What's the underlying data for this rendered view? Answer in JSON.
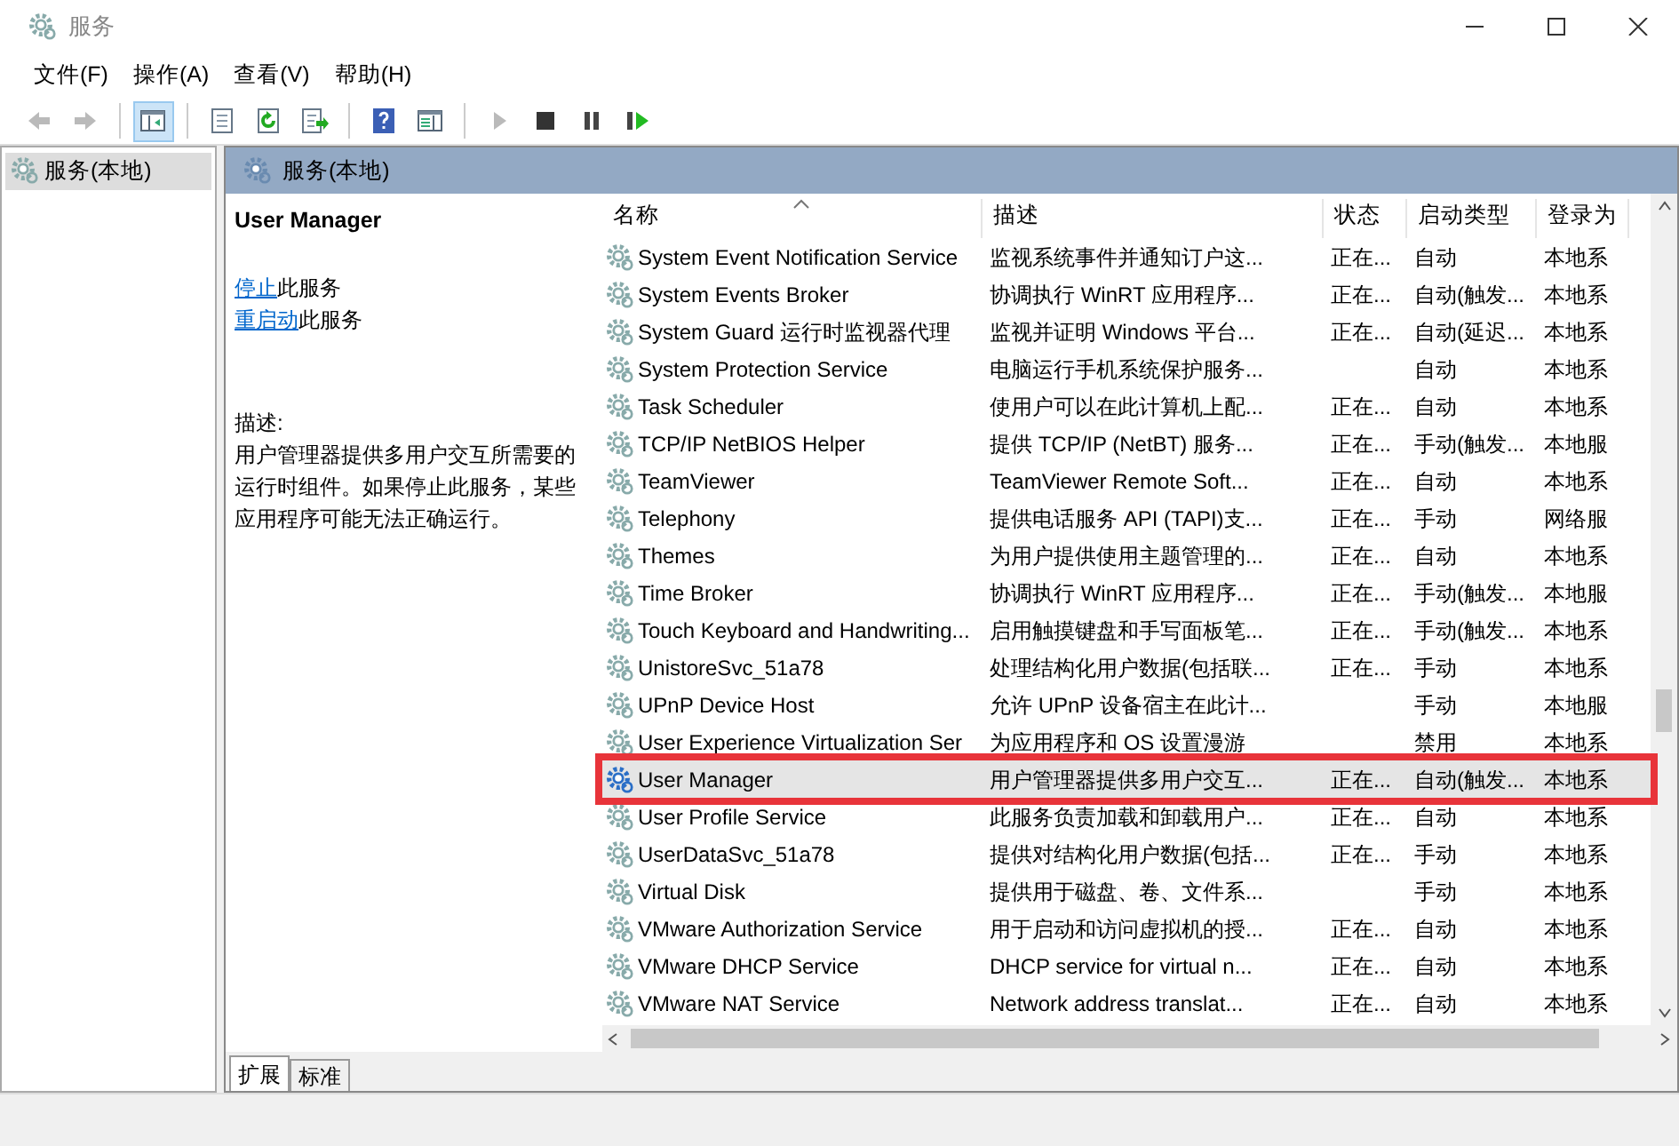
{
  "window": {
    "title": "服务"
  },
  "menu": [
    "文件(F)",
    "操作(A)",
    "查看(V)",
    "帮助(H)"
  ],
  "toolbar": [
    {
      "kind": "back",
      "disabled": true,
      "pressed": false
    },
    {
      "kind": "forward",
      "disabled": true,
      "pressed": false
    },
    {
      "kind": "tree",
      "disabled": false,
      "pressed": true
    },
    {
      "kind": "properties",
      "disabled": false,
      "pressed": false
    },
    {
      "kind": "refresh",
      "disabled": false,
      "pressed": false
    },
    {
      "kind": "export",
      "disabled": false,
      "pressed": false
    },
    {
      "kind": "help",
      "disabled": false,
      "pressed": false
    },
    {
      "kind": "view",
      "disabled": false,
      "pressed": false
    },
    {
      "kind": "start",
      "disabled": true,
      "pressed": false
    },
    {
      "kind": "stop",
      "disabled": false,
      "pressed": false
    },
    {
      "kind": "pause",
      "disabled": false,
      "pressed": false
    },
    {
      "kind": "restart",
      "disabled": false,
      "pressed": false
    }
  ],
  "tree": [
    {
      "label": "服务(本地)",
      "selected": true
    }
  ],
  "pane_header": "服务(本地)",
  "details": {
    "title": "User Manager",
    "actions": [
      {
        "link": "停止",
        "text": "此服务"
      },
      {
        "link": "重启动",
        "text": "此服务"
      }
    ],
    "description_label": "描述:",
    "description": "用户管理器提供多用户交互所需要的运行时组件。如果停止此服务，某些应用程序可能无法正确运行。"
  },
  "table": {
    "columns": [
      {
        "label": "名称",
        "sorted": true
      },
      {
        "label": "描述",
        "sorted": false
      },
      {
        "label": "状态",
        "sorted": false
      },
      {
        "label": "启动类型",
        "sorted": false
      },
      {
        "label": "登录为",
        "sorted": false
      }
    ],
    "rows": [
      {
        "cells": [
          "System Event Notification Service",
          "监视系统事件并通知订户这...",
          "正在...",
          "自动",
          "本地系"
        ],
        "selected": false,
        "outlined": false
      },
      {
        "cells": [
          "System Events Broker",
          "协调执行 WinRT 应用程序...",
          "正在...",
          "自动(触发...",
          "本地系"
        ],
        "selected": false,
        "outlined": false
      },
      {
        "cells": [
          "System Guard 运行时监视器代理",
          "监视并证明 Windows 平台...",
          "正在...",
          "自动(延迟...",
          "本地系"
        ],
        "selected": false,
        "outlined": false
      },
      {
        "cells": [
          "System Protection Service",
          "电脑运行手机系统保护服务...",
          "",
          "自动",
          "本地系"
        ],
        "selected": false,
        "outlined": false
      },
      {
        "cells": [
          "Task Scheduler",
          "使用户可以在此计算机上配...",
          "正在...",
          "自动",
          "本地系"
        ],
        "selected": false,
        "outlined": false
      },
      {
        "cells": [
          "TCP/IP NetBIOS Helper",
          "提供 TCP/IP (NetBT) 服务...",
          "正在...",
          "手动(触发...",
          "本地服"
        ],
        "selected": false,
        "outlined": false
      },
      {
        "cells": [
          "TeamViewer",
          "TeamViewer Remote Soft...",
          "正在...",
          "自动",
          "本地系"
        ],
        "selected": false,
        "outlined": false
      },
      {
        "cells": [
          "Telephony",
          "提供电话服务 API (TAPI)支...",
          "正在...",
          "手动",
          "网络服"
        ],
        "selected": false,
        "outlined": false
      },
      {
        "cells": [
          "Themes",
          "为用户提供使用主题管理的...",
          "正在...",
          "自动",
          "本地系"
        ],
        "selected": false,
        "outlined": false
      },
      {
        "cells": [
          "Time Broker",
          "协调执行 WinRT 应用程序...",
          "正在...",
          "手动(触发...",
          "本地服"
        ],
        "selected": false,
        "outlined": false
      },
      {
        "cells": [
          "Touch Keyboard and Handwriting...",
          "启用触摸键盘和手写面板笔...",
          "正在...",
          "手动(触发...",
          "本地系"
        ],
        "selected": false,
        "outlined": false
      },
      {
        "cells": [
          "UnistoreSvc_51a78",
          "处理结构化用户数据(包括联...",
          "正在...",
          "手动",
          "本地系"
        ],
        "selected": false,
        "outlined": false
      },
      {
        "cells": [
          "UPnP Device Host",
          "允许 UPnP 设备宿主在此计...",
          "",
          "手动",
          "本地服"
        ],
        "selected": false,
        "outlined": false
      },
      {
        "cells": [
          "User Experience Virtualization Ser",
          "为应用程序和 OS 设置漫游",
          "",
          "禁用",
          "本地系"
        ],
        "selected": false,
        "outlined": false
      },
      {
        "cells": [
          "User Manager",
          "用户管理器提供多用户交互...",
          "正在...",
          "自动(触发...",
          "本地系"
        ],
        "selected": true,
        "outlined": true
      },
      {
        "cells": [
          "User Profile Service",
          "此服务负责加载和卸载用户...",
          "正在...",
          "自动",
          "本地系"
        ],
        "selected": false,
        "outlined": false
      },
      {
        "cells": [
          "UserDataSvc_51a78",
          "提供对结构化用户数据(包括...",
          "正在...",
          "手动",
          "本地系"
        ],
        "selected": false,
        "outlined": false
      },
      {
        "cells": [
          "Virtual Disk",
          "提供用于磁盘、卷、文件系...",
          "",
          "手动",
          "本地系"
        ],
        "selected": false,
        "outlined": false
      },
      {
        "cells": [
          "VMware Authorization Service",
          "用于启动和访问虚拟机的授...",
          "正在...",
          "自动",
          "本地系"
        ],
        "selected": false,
        "outlined": false
      },
      {
        "cells": [
          "VMware DHCP Service",
          "DHCP service for virtual n...",
          "正在...",
          "自动",
          "本地系"
        ],
        "selected": false,
        "outlined": false
      },
      {
        "cells": [
          "VMware NAT Service",
          "Network address translat...",
          "正在...",
          "自动",
          "本地系"
        ],
        "selected": false,
        "outlined": false
      }
    ]
  },
  "bottom_tabs": [
    {
      "label": "扩展",
      "selected": true
    },
    {
      "label": "标准",
      "selected": false
    }
  ]
}
